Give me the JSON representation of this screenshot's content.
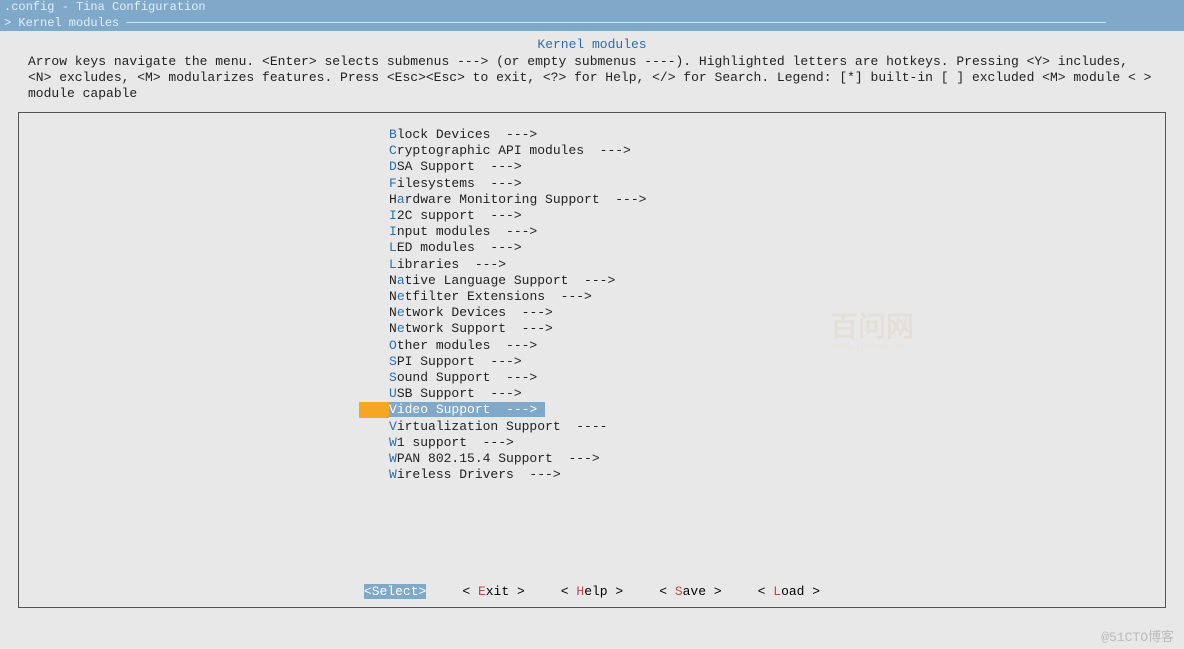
{
  "titlebar": ".config - Tina Configuration",
  "breadcrumb": "> Kernel modules ────────────────────────────────────────────────────────────────────────────────────────────────────────────────────────────────────────",
  "section_title": "Kernel modules",
  "instructions": "Arrow keys navigate the menu.  <Enter> selects submenus ---> (or empty submenus ----).  Highlighted letters are hotkeys.  Pressing <Y> includes, <N> excludes, <M> modularizes features.  Press <Esc><Esc> to exit, <?> for Help, </> for Search.  Legend: [*] built-in  [ ] excluded  <M> module  < > module capable",
  "menu": [
    {
      "hk": "B",
      "rest": "lock Devices  --->",
      "sel": false
    },
    {
      "hk": "C",
      "rest": "ryptographic API modules  --->",
      "sel": false
    },
    {
      "hk": "D",
      "rest": "SA Support  --->",
      "sel": false
    },
    {
      "hk": "F",
      "rest": "ilesystems  --->",
      "sel": false
    },
    {
      "pre": "H",
      "hk": "a",
      "rest": "rdware Monitoring Support  --->",
      "sel": false
    },
    {
      "hk": "I",
      "rest": "2C support  --->",
      "sel": false
    },
    {
      "hk": "I",
      "rest": "nput modules  --->",
      "sel": false
    },
    {
      "hk": "L",
      "rest": "ED modules  --->",
      "sel": false
    },
    {
      "hk": "L",
      "rest": "ibraries  --->",
      "sel": false
    },
    {
      "pre": "N",
      "hk": "a",
      "rest": "tive Language Support  --->",
      "sel": false
    },
    {
      "pre": "N",
      "hk": "e",
      "rest": "tfilter Extensions  --->",
      "sel": false
    },
    {
      "pre": "N",
      "hk": "e",
      "rest": "twork Devices  --->",
      "sel": false
    },
    {
      "pre": "N",
      "hk": "e",
      "rest": "twork Support  --->",
      "sel": false
    },
    {
      "hk": "O",
      "rest": "ther modules  --->",
      "sel": false
    },
    {
      "hk": "S",
      "rest": "PI Support  --->",
      "sel": false
    },
    {
      "hk": "S",
      "rest": "ound Support  --->",
      "sel": false
    },
    {
      "hk": "U",
      "rest": "SB Support  --->",
      "sel": false
    },
    {
      "hk": "V",
      "rest": "ideo Support  ---> ",
      "sel": true
    },
    {
      "hk": "V",
      "rest": "irtualization Support  ----",
      "sel": false
    },
    {
      "hk": "W",
      "rest": "1 support  --->",
      "sel": false
    },
    {
      "hk": "W",
      "rest": "PAN 802.15.4 Support  --->",
      "sel": false
    },
    {
      "hk": "W",
      "rest": "ireless Drivers  --->",
      "sel": false
    }
  ],
  "buttons": [
    {
      "label": "<Select>",
      "hk": "S",
      "pre": "<",
      "mid": "elect>",
      "active": true
    },
    {
      "label": "< Exit >",
      "hk": "E",
      "pre": "< ",
      "mid": "xit >",
      "active": false
    },
    {
      "label": "< Help >",
      "hk": "H",
      "pre": "< ",
      "mid": "elp >",
      "active": false
    },
    {
      "label": "< Save >",
      "hk": "S",
      "pre": "< ",
      "mid": "ave >",
      "active": false
    },
    {
      "label": "< Load >",
      "hk": "L",
      "pre": "< ",
      "mid": "oad >",
      "active": false
    }
  ],
  "watermark": "@51CTO博客",
  "wm2": "百问网",
  "wm2b": "www.100ask.net"
}
